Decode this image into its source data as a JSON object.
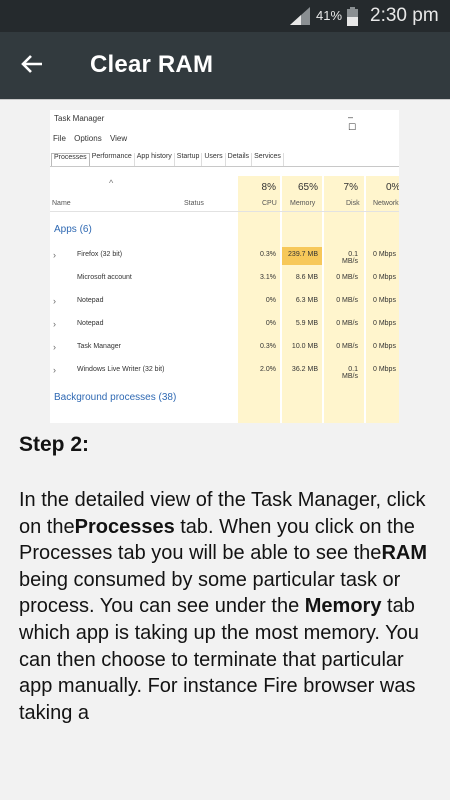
{
  "status_bar": {
    "battery_pct": "41%",
    "time": "2:30 pm"
  },
  "app_bar": {
    "title": "Clear RAM",
    "back_icon": "arrow-left"
  },
  "screenshot": {
    "window_title": "Task Manager",
    "window_buttons": "– ☐",
    "menu": [
      "File",
      "Options",
      "View"
    ],
    "tabs": [
      "Processes",
      "Performance",
      "App history",
      "Startup",
      "Users",
      "Details",
      "Services"
    ],
    "columns": {
      "name": "Name",
      "status": "Status",
      "cpu": "CPU",
      "memory": "Memory",
      "disk": "Disk",
      "network": "Network"
    },
    "usage": {
      "cpu": "8%",
      "memory": "65%",
      "disk": "7%",
      "network": "0%"
    },
    "apps_label": "Apps (6)",
    "apps": [
      {
        "name": "Firefox (32 bit)",
        "cpu": "0.3%",
        "mem": "239.7 MB",
        "disk": "0.1 MB/s",
        "net": "0 Mbps",
        "expand": true
      },
      {
        "name": "Microsoft account",
        "cpu": "3.1%",
        "mem": "8.6 MB",
        "disk": "0 MB/s",
        "net": "0 Mbps",
        "expand": false
      },
      {
        "name": "Notepad",
        "cpu": "0%",
        "mem": "6.3 MB",
        "disk": "0 MB/s",
        "net": "0 Mbps",
        "expand": true
      },
      {
        "name": "Notepad",
        "cpu": "0%",
        "mem": "5.9 MB",
        "disk": "0 MB/s",
        "net": "0 Mbps",
        "expand": true
      },
      {
        "name": "Task Manager",
        "cpu": "0.3%",
        "mem": "10.0 MB",
        "disk": "0 MB/s",
        "net": "0 Mbps",
        "expand": true
      },
      {
        "name": "Windows Live Writer (32 bit)",
        "cpu": "2.0%",
        "mem": "36.2 MB",
        "disk": "0.1 MB/s",
        "net": "0 Mbps",
        "expand": true
      }
    ],
    "background_label": "Background processes (38)"
  },
  "content": {
    "step_title": "Step 2:",
    "p1": " In the detailed view of the Task Manager, click on the",
    "b1": "Processes",
    "p2": " tab. When you click on the Processes tab you will be able to see the",
    "b2": "RAM",
    "p3": " being consumed by some particular task or process. You can see under the ",
    "b3": "Memory",
    "p4": " tab which app is taking up the most memory. You can then choose to terminate that particular app manually. For instance Fire browser was taking a"
  }
}
